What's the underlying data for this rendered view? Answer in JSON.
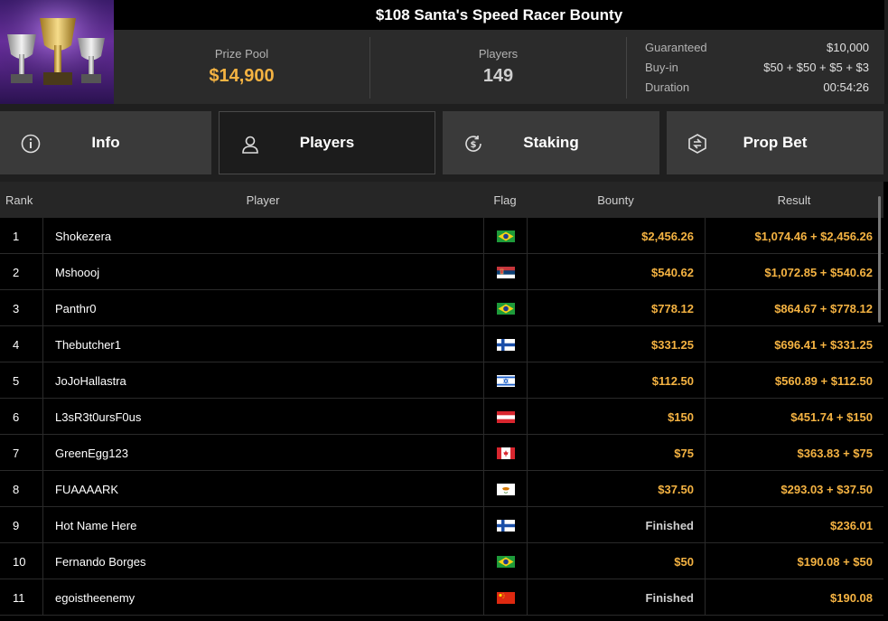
{
  "header": {
    "title": "$108 Santa's Speed Racer Bounty",
    "prize_pool_label": "Prize Pool",
    "prize_pool_value": "$14,900",
    "players_label": "Players",
    "players_value": "149",
    "details": [
      {
        "label": "Guaranteed",
        "value": "$10,000"
      },
      {
        "label": "Buy-in",
        "value": "$50 + $50 + $5 + $3"
      },
      {
        "label": "Duration",
        "value": "00:54:26"
      }
    ],
    "accent": "#f5b342"
  },
  "tabs": [
    {
      "label": "Info",
      "icon": "info-icon",
      "active": false
    },
    {
      "label": "Players",
      "icon": "user-icon",
      "active": true
    },
    {
      "label": "Staking",
      "icon": "staking-icon",
      "active": false
    },
    {
      "label": "Prop Bet",
      "icon": "prop-bet-icon",
      "active": false
    }
  ],
  "table": {
    "columns": {
      "rank": "Rank",
      "player": "Player",
      "flag": "Flag",
      "bounty": "Bounty",
      "result": "Result"
    },
    "rows": [
      {
        "rank": "1",
        "player": "Shokezera",
        "flag": "brazil-flag",
        "bounty": "$2,456.26",
        "result": "$1,074.46 + $2,456.26"
      },
      {
        "rank": "2",
        "player": "Mshoooj",
        "flag": "serbia-flag",
        "bounty": "$540.62",
        "result": "$1,072.85 + $540.62"
      },
      {
        "rank": "3",
        "player": "Panthr0",
        "flag": "brazil-flag",
        "bounty": "$778.12",
        "result": "$864.67 + $778.12"
      },
      {
        "rank": "4",
        "player": "Thebutcher1",
        "flag": "finland-flag",
        "bounty": "$331.25",
        "result": "$696.41 + $331.25"
      },
      {
        "rank": "5",
        "player": "JoJoHallastra",
        "flag": "israel-flag",
        "bounty": "$112.50",
        "result": "$560.89 + $112.50"
      },
      {
        "rank": "6",
        "player": "L3sR3t0ursF0us",
        "flag": "austria-flag",
        "bounty": "$150",
        "result": "$451.74 + $150"
      },
      {
        "rank": "7",
        "player": "GreenEgg123",
        "flag": "canada-flag",
        "bounty": "$75",
        "result": "$363.83 + $75"
      },
      {
        "rank": "8",
        "player": "FUAAAARK",
        "flag": "cyprus-flag",
        "bounty": "$37.50",
        "result": "$293.03 + $37.50"
      },
      {
        "rank": "9",
        "player": "Hot Name Here",
        "flag": "finland-flag",
        "bounty": "Finished",
        "result": "$236.01"
      },
      {
        "rank": "10",
        "player": "Fernando Borges",
        "flag": "brazil-flag",
        "bounty": "$50",
        "result": "$190.08 + $50"
      },
      {
        "rank": "11",
        "player": "egoistheenemy",
        "flag": "china-flag",
        "bounty": "Finished",
        "result": "$190.08"
      }
    ]
  }
}
